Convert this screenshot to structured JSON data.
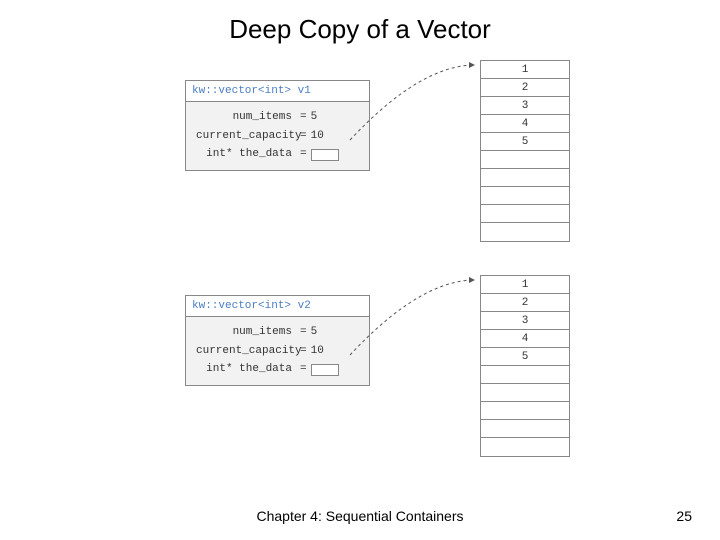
{
  "title": "Deep Copy of a Vector",
  "v1": {
    "header": "kw::vector<int> v1",
    "num_items_label": "num_items",
    "num_items_value": "5",
    "capacity_label": "current_capacity",
    "capacity_value": "10",
    "data_label": "int* the_data",
    "eq": "="
  },
  "v2": {
    "header": "kw::vector<int> v2",
    "num_items_label": "num_items",
    "num_items_value": "5",
    "capacity_label": "current_capacity",
    "capacity_value": "10",
    "data_label": "int* the_data",
    "eq": "="
  },
  "array1": [
    "1",
    "2",
    "3",
    "4",
    "5",
    "",
    "",
    "",
    "",
    ""
  ],
  "array2": [
    "1",
    "2",
    "3",
    "4",
    "5",
    "",
    "",
    "",
    "",
    ""
  ],
  "footer": {
    "chapter": "Chapter 4: Sequential Containers",
    "page": "25"
  }
}
